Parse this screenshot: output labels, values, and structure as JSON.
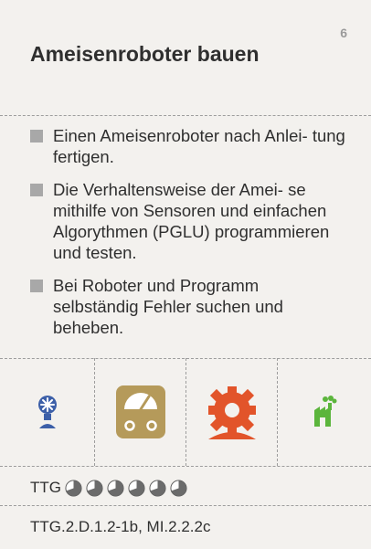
{
  "card": {
    "number": "6",
    "title": "Ameisenroboter bauen",
    "bullets": [
      "Einen Ameisenroboter nach Anlei- tung fertigen.",
      "Die Verhaltensweise der Amei- se mithilfe von Sensoren und einfachen Algorythmen (PGLU) programmieren und testen.",
      "Bei Roboter und Programm selbständig Fehler suchen und beheben."
    ],
    "icons": [
      {
        "name": "lamp-icon",
        "color": "#3c5fa8"
      },
      {
        "name": "gauge-meter-icon",
        "color": "#b59a5a"
      },
      {
        "name": "gear-icon",
        "color": "#e2542a"
      },
      {
        "name": "factory-icon",
        "color": "#5bb53c"
      }
    ],
    "rating_label": "TTG",
    "rating_count": 6,
    "code": "TTG.2.D.1.2-1b, MI.2.2.2c"
  }
}
